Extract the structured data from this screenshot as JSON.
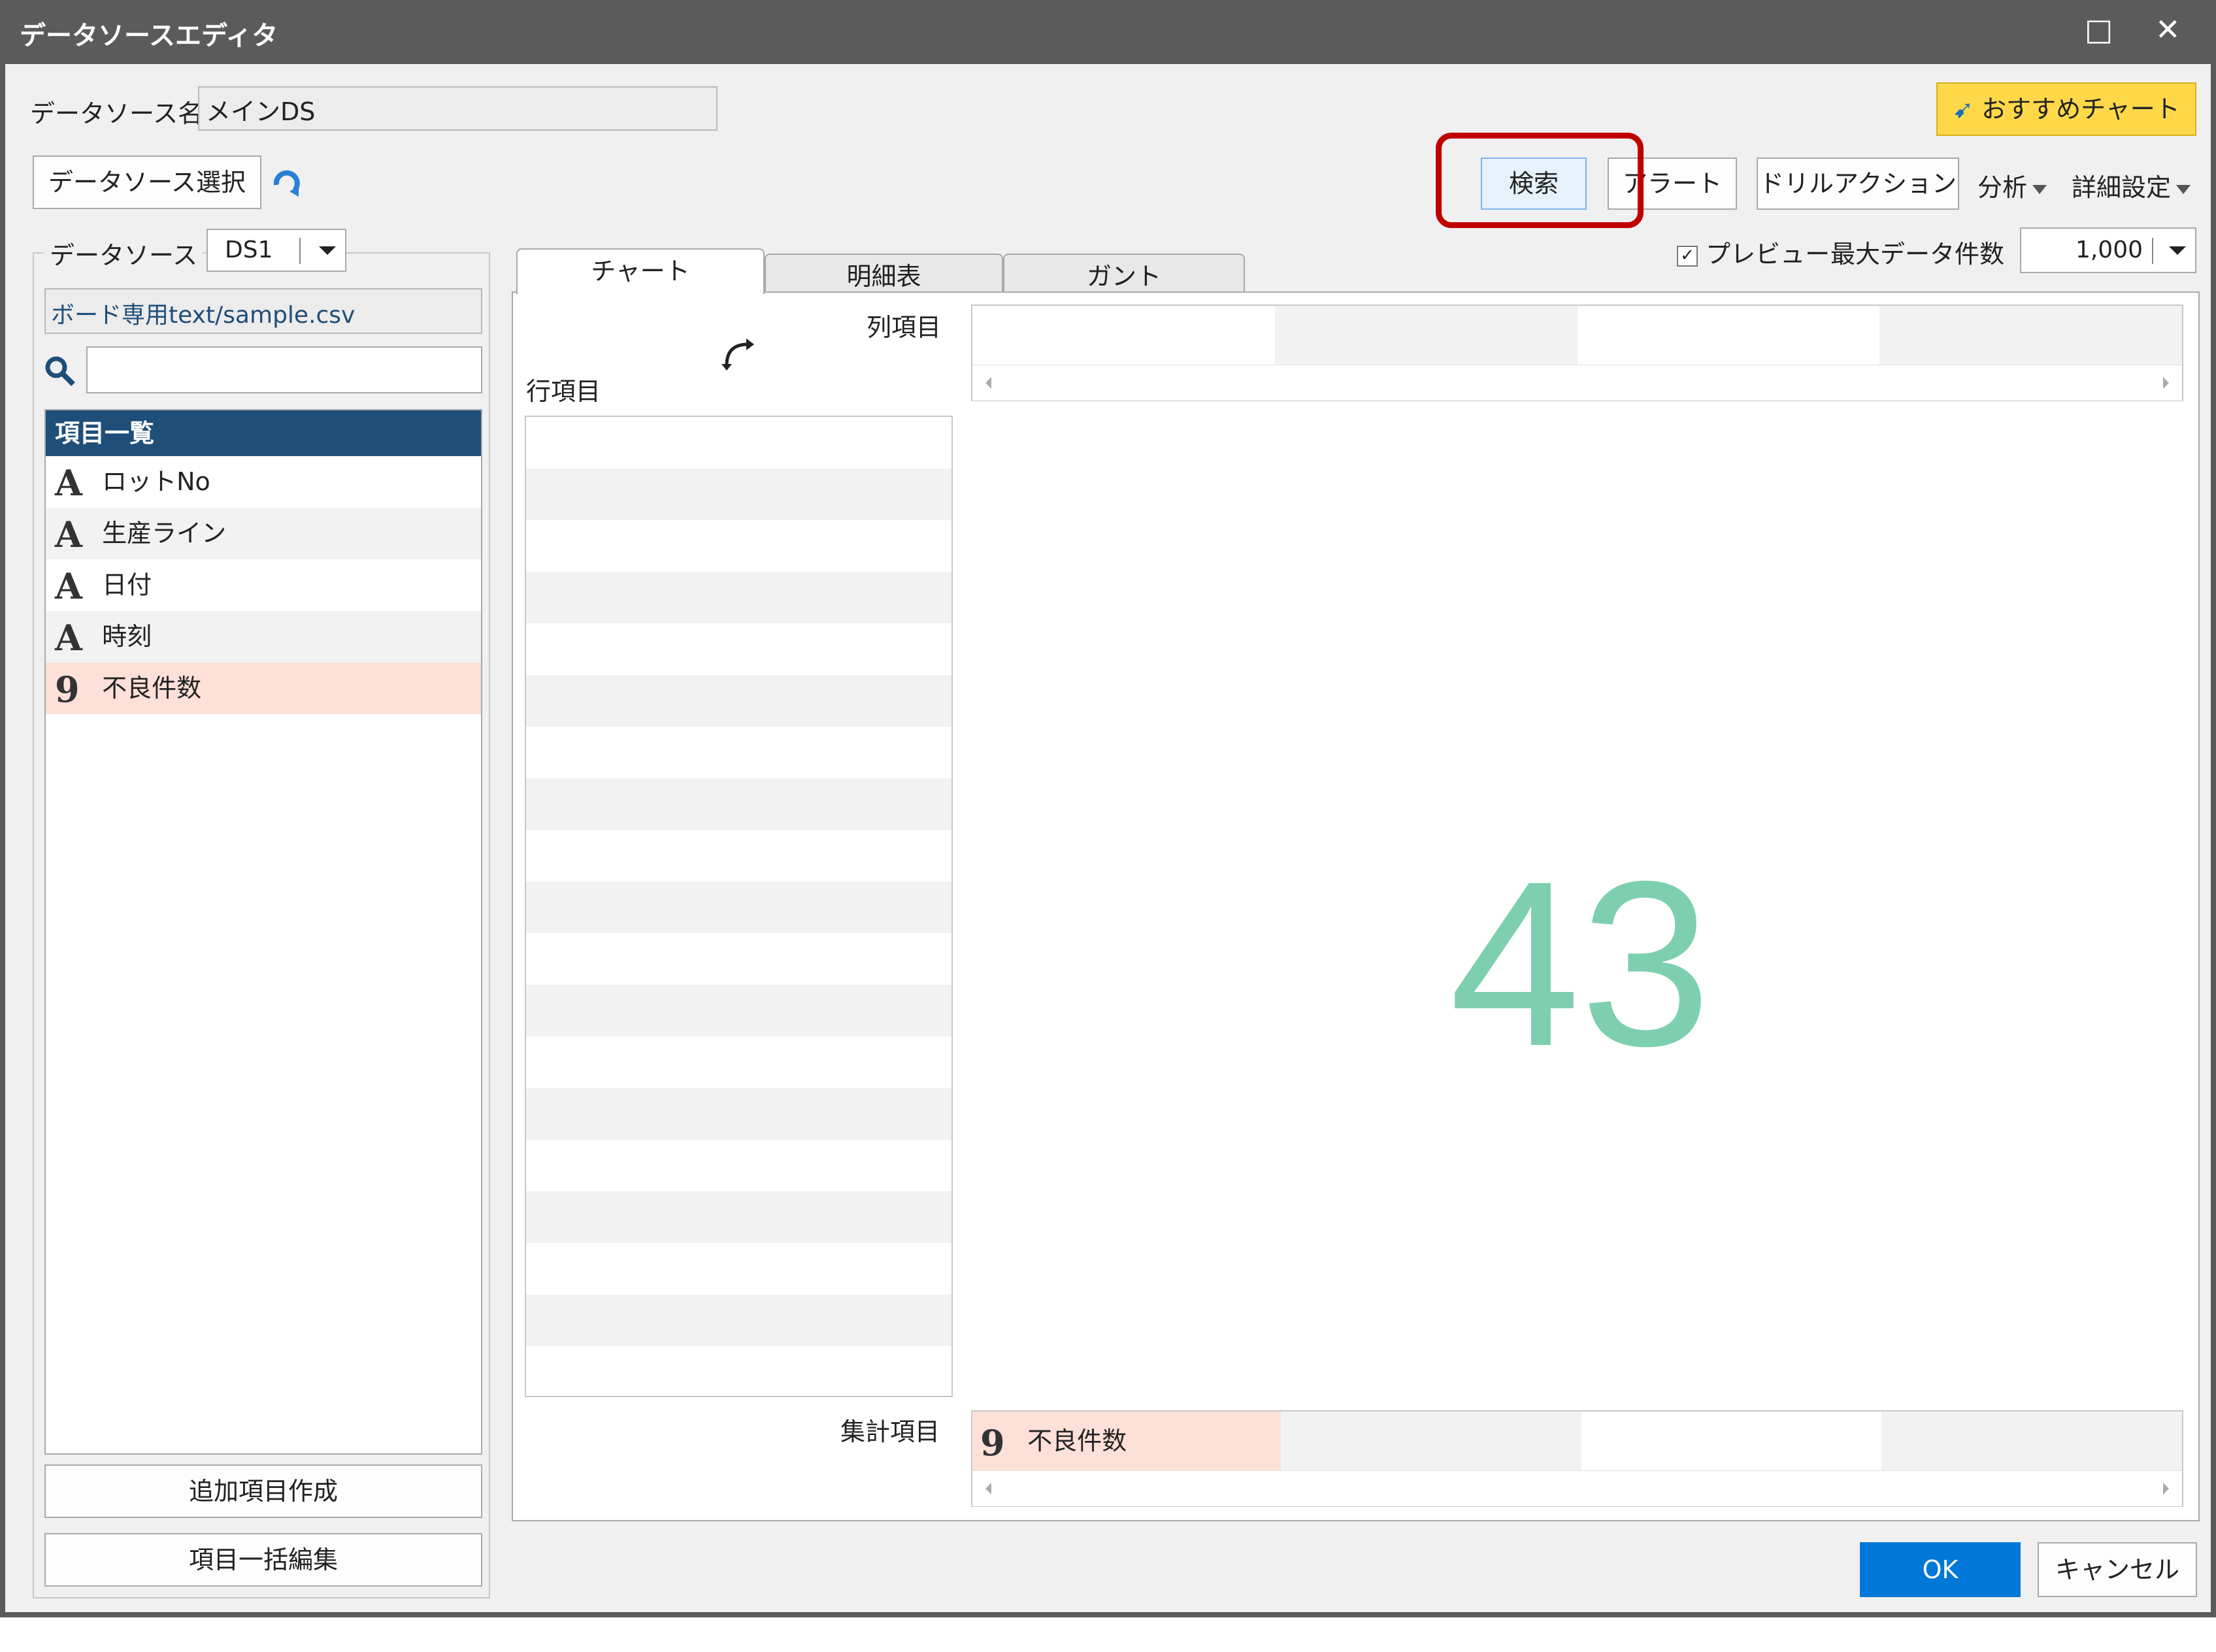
{
  "window": {
    "title": "データソースエディタ",
    "maximize_glyph": "□",
    "close_glyph": "✕"
  },
  "datasource_name": {
    "label": "データソース名",
    "value": "メインDS"
  },
  "toolbar": {
    "select_datasource": "データソース選択",
    "recommend_chart": "おすすめチャート",
    "search": "検索",
    "alert": "アラート",
    "drill_action": "ドリルアクション",
    "analysis": "分析",
    "detail_settings": "詳細設定"
  },
  "datasource_group": {
    "label": "データソース",
    "selected": "DS1",
    "file": "ボード専用text/sample.csv",
    "search_placeholder": ""
  },
  "fields": {
    "header": "項目一覧",
    "items": [
      {
        "type": "A",
        "label": "ロットNo"
      },
      {
        "type": "A",
        "label": "生産ライン"
      },
      {
        "type": "A",
        "label": "日付"
      },
      {
        "type": "A",
        "label": "時刻"
      },
      {
        "type": "9",
        "label": "不良件数"
      }
    ],
    "add_button": "追加項目作成",
    "bulk_edit_button": "項目一括編集"
  },
  "tabs": [
    "チャート",
    "明細表",
    "ガント"
  ],
  "preview": {
    "label": "プレビュー",
    "checked": true
  },
  "max_rows": {
    "label": "最大データ件数",
    "value": "1,000"
  },
  "chart_area": {
    "column_items_label": "列項目",
    "row_items_label": "行項目",
    "aggregate_items_label": "集計項目",
    "aggregate_field": {
      "type": "9",
      "label": "不良件数"
    },
    "display_value": "43"
  },
  "footer": {
    "ok": "OK",
    "cancel": "キャンセル"
  },
  "colors": {
    "accent": "#0078d7",
    "value_text": "#7dcfb0",
    "highlight": "#c00000",
    "selected_row": "#fde0d8"
  }
}
